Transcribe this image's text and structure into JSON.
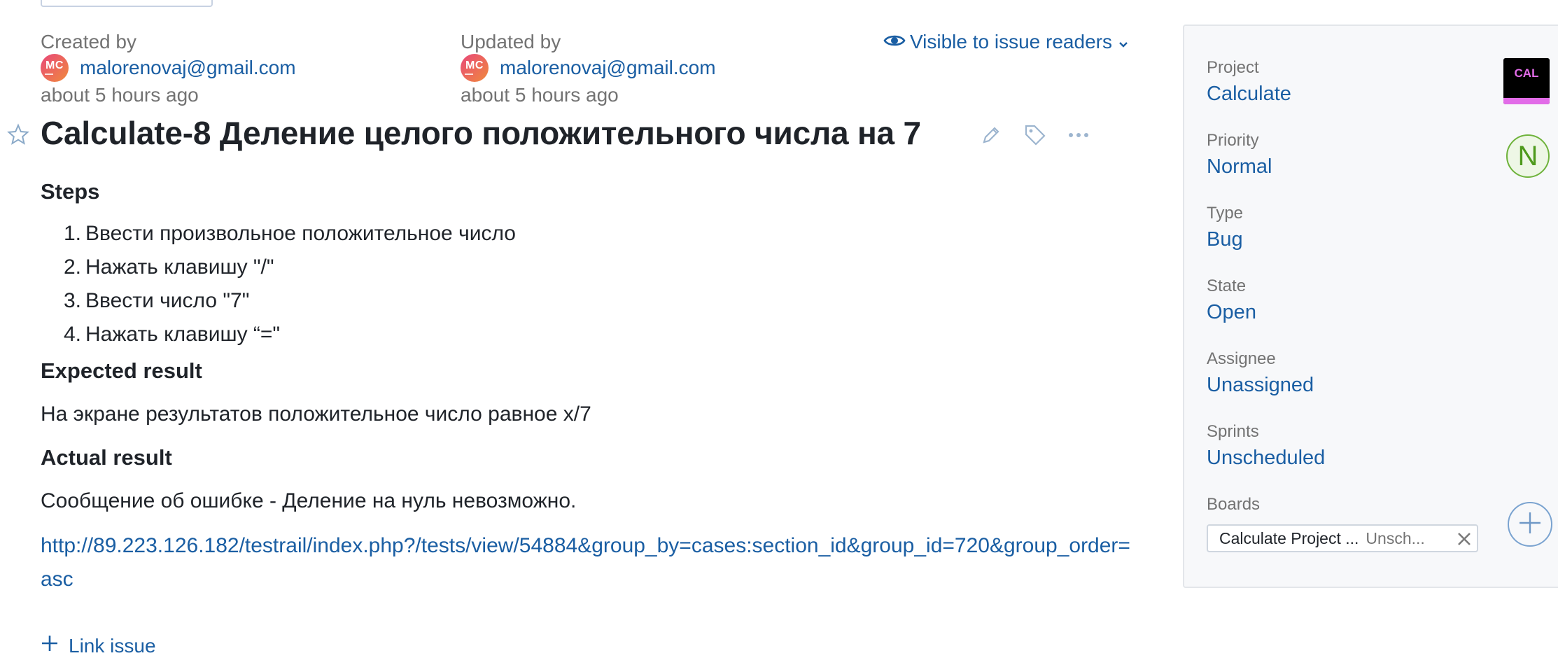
{
  "meta": {
    "created_label": "Created by",
    "created_avatar": "MC",
    "created_email": "malorenovaj@gmail.com",
    "created_time": "about 5 hours ago",
    "updated_label": "Updated by",
    "updated_avatar": "MC",
    "updated_email": "malorenovaj@gmail.com",
    "updated_time": "about 5 hours ago",
    "visibility": "Visible to issue readers"
  },
  "issue": {
    "title": "Calculate-8 Деление целого положительного числа на 7"
  },
  "description": {
    "steps_heading": "Steps",
    "steps": [
      {
        "num": "1.",
        "text": "Ввести произвольное положительное число"
      },
      {
        "num": "2.",
        "text": "Нажать клавишу \"/\""
      },
      {
        "num": "3.",
        "text": "Ввести число \"7\""
      },
      {
        "num": "4.",
        "text": "Нажать клавишу “=\""
      }
    ],
    "expected_heading": "Expected result",
    "expected_text": "На экране результатов положительное число равное х/7",
    "actual_heading": "Actual result",
    "actual_text": "Сообщение об ошибке - Деление на нуль невозможно.",
    "link": "http://89.223.126.182/testrail/index.php?/tests/view/54884&group_by=cases:section_id&group_id=720&group_order=asc"
  },
  "actions": {
    "link_issue": "Link issue"
  },
  "sidebar": {
    "project_label": "Project",
    "project_value": "Calculate",
    "project_badge": "CAL",
    "priority_label": "Priority",
    "priority_value": "Normal",
    "priority_badge": "N",
    "type_label": "Type",
    "type_value": "Bug",
    "state_label": "State",
    "state_value": "Open",
    "assignee_label": "Assignee",
    "assignee_value": "Unassigned",
    "sprints_label": "Sprints",
    "sprints_value": "Unscheduled",
    "boards_label": "Boards",
    "board_name": "Calculate Project ...",
    "board_sprint": "Unsch..."
  },
  "colors": {
    "link": "#1a5ea3",
    "muted": "#737373",
    "project_badge_bg": "#000000",
    "project_badge_accent": "#e26ce8",
    "priority_green": "#6fb33c"
  },
  "icons": [
    "eye-icon",
    "chevron-down-icon",
    "star-icon",
    "pencil-icon",
    "tag-icon",
    "more-icon",
    "plus-icon",
    "close-icon"
  ]
}
